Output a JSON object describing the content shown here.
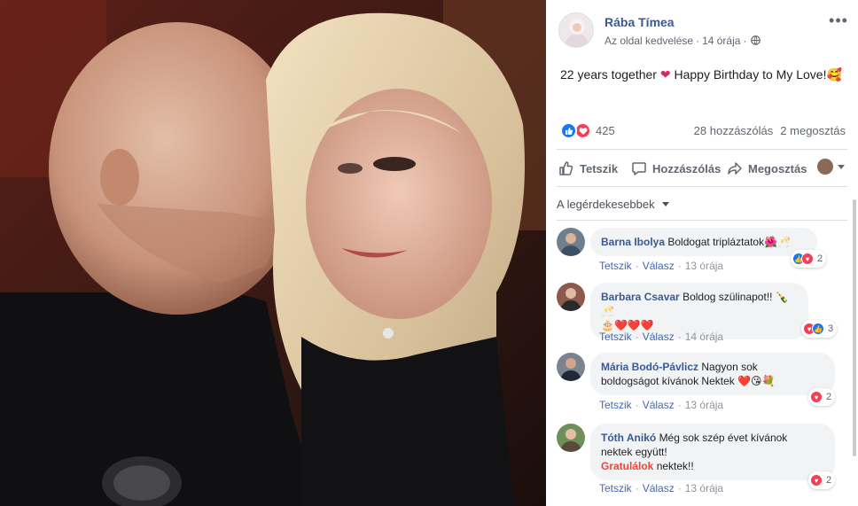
{
  "post": {
    "page_name": "Rába Tímea",
    "meta_label": "Az oldal kedvelése",
    "time": "14 órája",
    "text": "22 years together",
    "text_after": "Happy Birthday to My Love!",
    "emoji_heart": "❤",
    "emoji_end": "🥰"
  },
  "reactions": {
    "count": "425",
    "comments": "28 hozzászólás",
    "shares": "2 megosztás"
  },
  "actions": {
    "like": "Tetszik",
    "comment": "Hozzászólás",
    "share": "Megosztás"
  },
  "sort": {
    "label": "A legérdekesebbek"
  },
  "comments": [
    {
      "name": "Barna Ibolya",
      "text": "Boldogat tripláztatok",
      "emoji": "🌺🥂",
      "like": "Tetszik",
      "reply": "Válasz",
      "time": "13 órája",
      "reaction_count": "2"
    },
    {
      "name": "Barbara Csavar",
      "text": "Boldog szülinapot!!",
      "emoji": "🍾🥂",
      "line2": "🎂❤️❤️❤️",
      "like": "Tetszik",
      "reply": "Válasz",
      "time": "14 órája",
      "reaction_count": "3"
    },
    {
      "name": "Mária Bodó-Pávlicz",
      "text": "Nagyon sok",
      "line2": "boldogságot kívánok Nektek ❤️😘💐",
      "like": "Tetszik",
      "reply": "Válasz",
      "time": "13 órája",
      "reaction_count": "2"
    },
    {
      "name": "Tóth Anikó",
      "text": "Még sok szép évet kívánok",
      "line2": "nektek együtt!",
      "link": "Gratulálok",
      "line3_rest": " nektek!!",
      "like": "Tetszik",
      "reply": "Válasz",
      "time": "13 órája",
      "reaction_count": "2"
    }
  ],
  "colors": {
    "link_blue": "#385898",
    "meta_grey": "#606770",
    "bubble_bg": "#f2f3f5",
    "like_blue": "#1877f2",
    "love_red": "#f33e58"
  }
}
